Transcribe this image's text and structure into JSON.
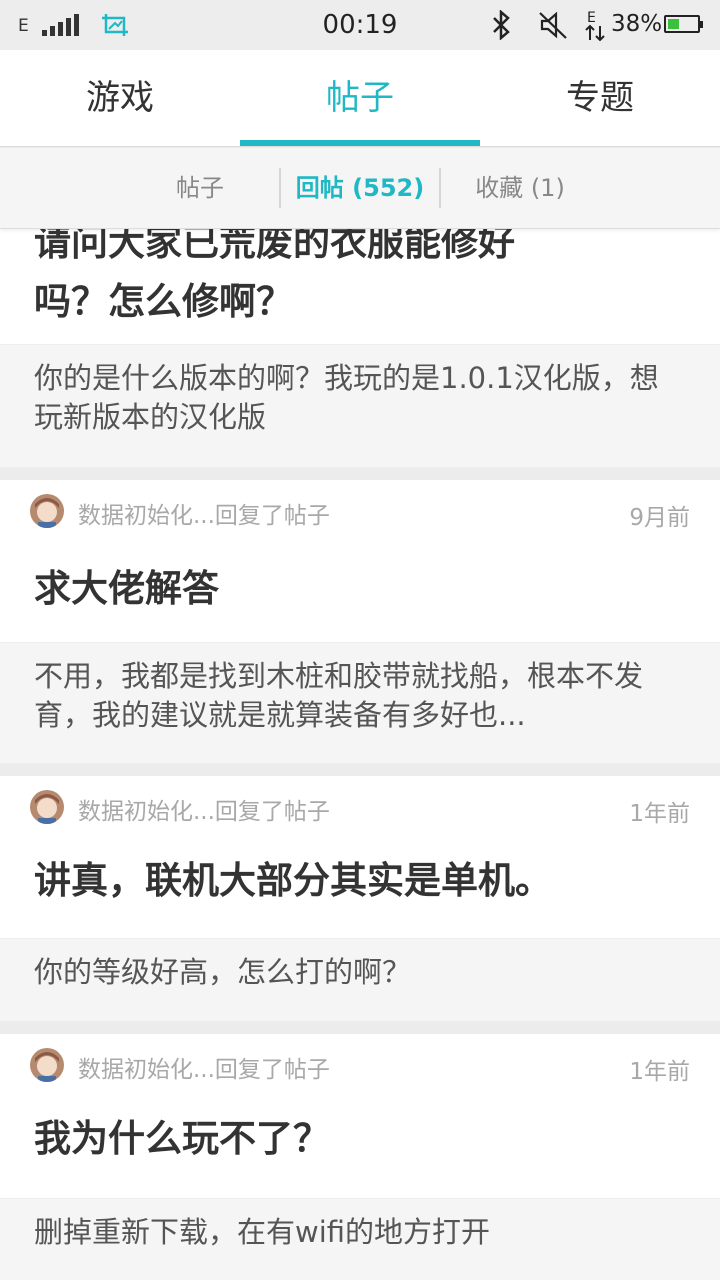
{
  "status_bar": {
    "network": "E",
    "time": "00:19",
    "battery_pct": "38%",
    "battery_level": 0.38,
    "icons": [
      "signal-icon",
      "screenshot-icon",
      "bluetooth-icon",
      "mute-icon",
      "data-arrows-icon",
      "battery-icon"
    ]
  },
  "top_tabs": [
    {
      "label": "游戏",
      "active": false
    },
    {
      "label": "帖子",
      "active": true
    },
    {
      "label": "专题",
      "active": false
    }
  ],
  "sub_tabs": [
    {
      "label": "帖子",
      "active": false
    },
    {
      "label": "回帖 (552)",
      "active": true
    },
    {
      "label": "收藏 (1)",
      "active": false
    }
  ],
  "posts": [
    {
      "user": "",
      "time": "",
      "title_line1": "请问大家已荒废的衣服能修好",
      "title_line2": "吗？怎么修啊？",
      "reply": "你的是什么版本的啊？我玩的是1.0.1汉化版，想玩新版本的汉化版"
    },
    {
      "user": "数据初始化...回复了帖子",
      "time": "9月前",
      "title": "求大佬解答",
      "reply": "不用，我都是找到木桩和胶带就找船，根本不发育，我的建议就是就算装备有多好也..."
    },
    {
      "user": "数据初始化...回复了帖子",
      "time": "1年前",
      "title": "讲真，联机大部分其实是单机。",
      "reply": "你的等级好高，怎么打的啊？"
    },
    {
      "user": "数据初始化...回复了帖子",
      "time": "1年前",
      "title": "我为什么玩不了？",
      "reply": "删掉重新下载，在有wifi的地方打开"
    }
  ],
  "colors": {
    "accent": "#1fb8c4",
    "text_primary": "#333333",
    "text_secondary": "#a8a8a8",
    "reply_bg": "#f5f5f5"
  }
}
